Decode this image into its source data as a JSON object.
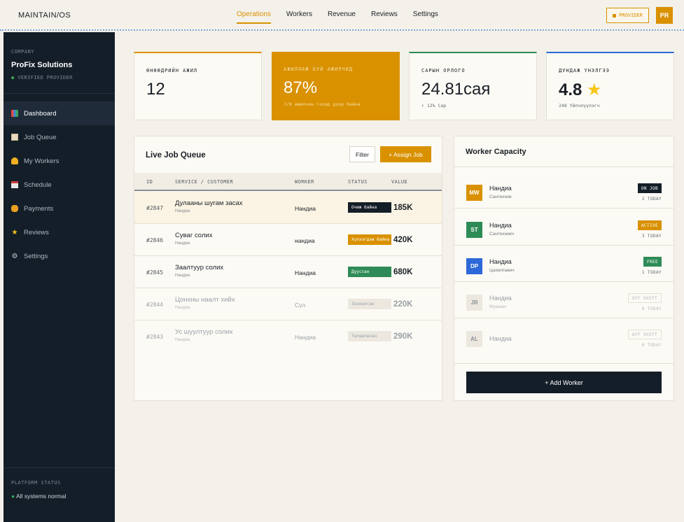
{
  "header": {
    "brand": "MAINTAIN/OS",
    "nav": [
      "Operations",
      "Workers",
      "Revenue",
      "Reviews",
      "Settings"
    ],
    "active_nav": "Operations",
    "provider_badge": "PROVIDER",
    "avatar": "PR"
  },
  "sidebar": {
    "company_label": "COMPANY",
    "company_name": "ProFix Solutions",
    "verified": "VERIFIED PROVIDER",
    "items": [
      {
        "label": "Dashboard",
        "icon": "dashboard-icon"
      },
      {
        "label": "Job Queue",
        "icon": "clipboard-icon"
      },
      {
        "label": "My Workers",
        "icon": "worker-icon"
      },
      {
        "label": "Schedule",
        "icon": "calendar-icon"
      },
      {
        "label": "Payments",
        "icon": "money-bag-icon"
      },
      {
        "label": "Reviews",
        "icon": "star-icon"
      },
      {
        "label": "Settings",
        "icon": "gear-icon"
      }
    ],
    "platform_label": "PLATFORM STATUS",
    "platform_status": "All systems normal"
  },
  "kpis": [
    {
      "label": "ӨНӨӨДРИЙН АЖИЛ",
      "value": "12",
      "sub": ""
    },
    {
      "label": "АЖИЛЛАЖ БУЙ АЖИЛЧИД",
      "value": "87%",
      "sub": "7/8 ажилчин газар дээр байна"
    },
    {
      "label": "САРЫН ОРЛОГО",
      "value": "24.81сая",
      "sub": "↑ 12% Сар"
    },
    {
      "label": "ДУНДАЖ ҮНЭЛГЭЭ",
      "value": "4.8",
      "star": "★",
      "sub": "248 Үйлчлүүлэгч"
    }
  ],
  "job_queue": {
    "title": "Live Job Queue",
    "filter_label": "Filter",
    "assign_label": "+ Assign Job",
    "columns": [
      "ID",
      "SERVICE / CUSTOMER",
      "WORKER",
      "STATUS",
      "VALUE"
    ],
    "rows": [
      {
        "id": "#2847",
        "service": "Дулааны шугам засах",
        "customer": "Нандиа",
        "worker": "Нандиа",
        "status": "Очиж байна",
        "value": "185K"
      },
      {
        "id": "#2846",
        "service": "Суваг солих",
        "customer": "Нандиа",
        "worker": "нандиа",
        "status": "Хүлээгдэж байна",
        "value": "420K"
      },
      {
        "id": "#2845",
        "service": "Заалтуур солих",
        "customer": "Нандиа",
        "worker": "Нандиа",
        "status": "Дууссан",
        "value": "680K"
      },
      {
        "id": "#2844",
        "service": "Цонхны наалт хийх",
        "customer": "Нандиа",
        "worker": "Сүл",
        "status": "Захиалсан",
        "value": "220K"
      },
      {
        "id": "#2843",
        "service": "Ус шуултуур солих",
        "customer": "Нандиа",
        "worker": "Нандиа",
        "status": "Төлөвлөсөн",
        "value": "290K"
      }
    ]
  },
  "worker_capacity": {
    "title": "Worker Capacity",
    "workers": [
      {
        "initials": "MW",
        "name": "Нандиа",
        "role": "Сантехник",
        "badge": "ON JOB",
        "today": "2 TODAY"
      },
      {
        "initials": "ST",
        "name": "Нандиа",
        "role": "Сантехникч",
        "badge": "ACTIVE",
        "today": "3 TODAY"
      },
      {
        "initials": "DP",
        "name": "Нандиа",
        "role": "Цахилгаанч",
        "badge": "FREE",
        "today": "1 TODAY"
      },
      {
        "initials": "JR",
        "name": "Нандиа",
        "role": "Мужаан",
        "badge": "OFF SHIFT",
        "today": "0 TODAY"
      },
      {
        "initials": "AL",
        "name": "Нандиа",
        "role": "",
        "badge": "OFF SHIFT",
        "today": "0 TODAY"
      }
    ],
    "add_label": "+ Add Worker"
  },
  "colors": {
    "accent": "#d99100",
    "sidebar": "#141e28",
    "green": "#2e8b57",
    "blue": "#2c68d8",
    "background": "#f4f1ea"
  }
}
